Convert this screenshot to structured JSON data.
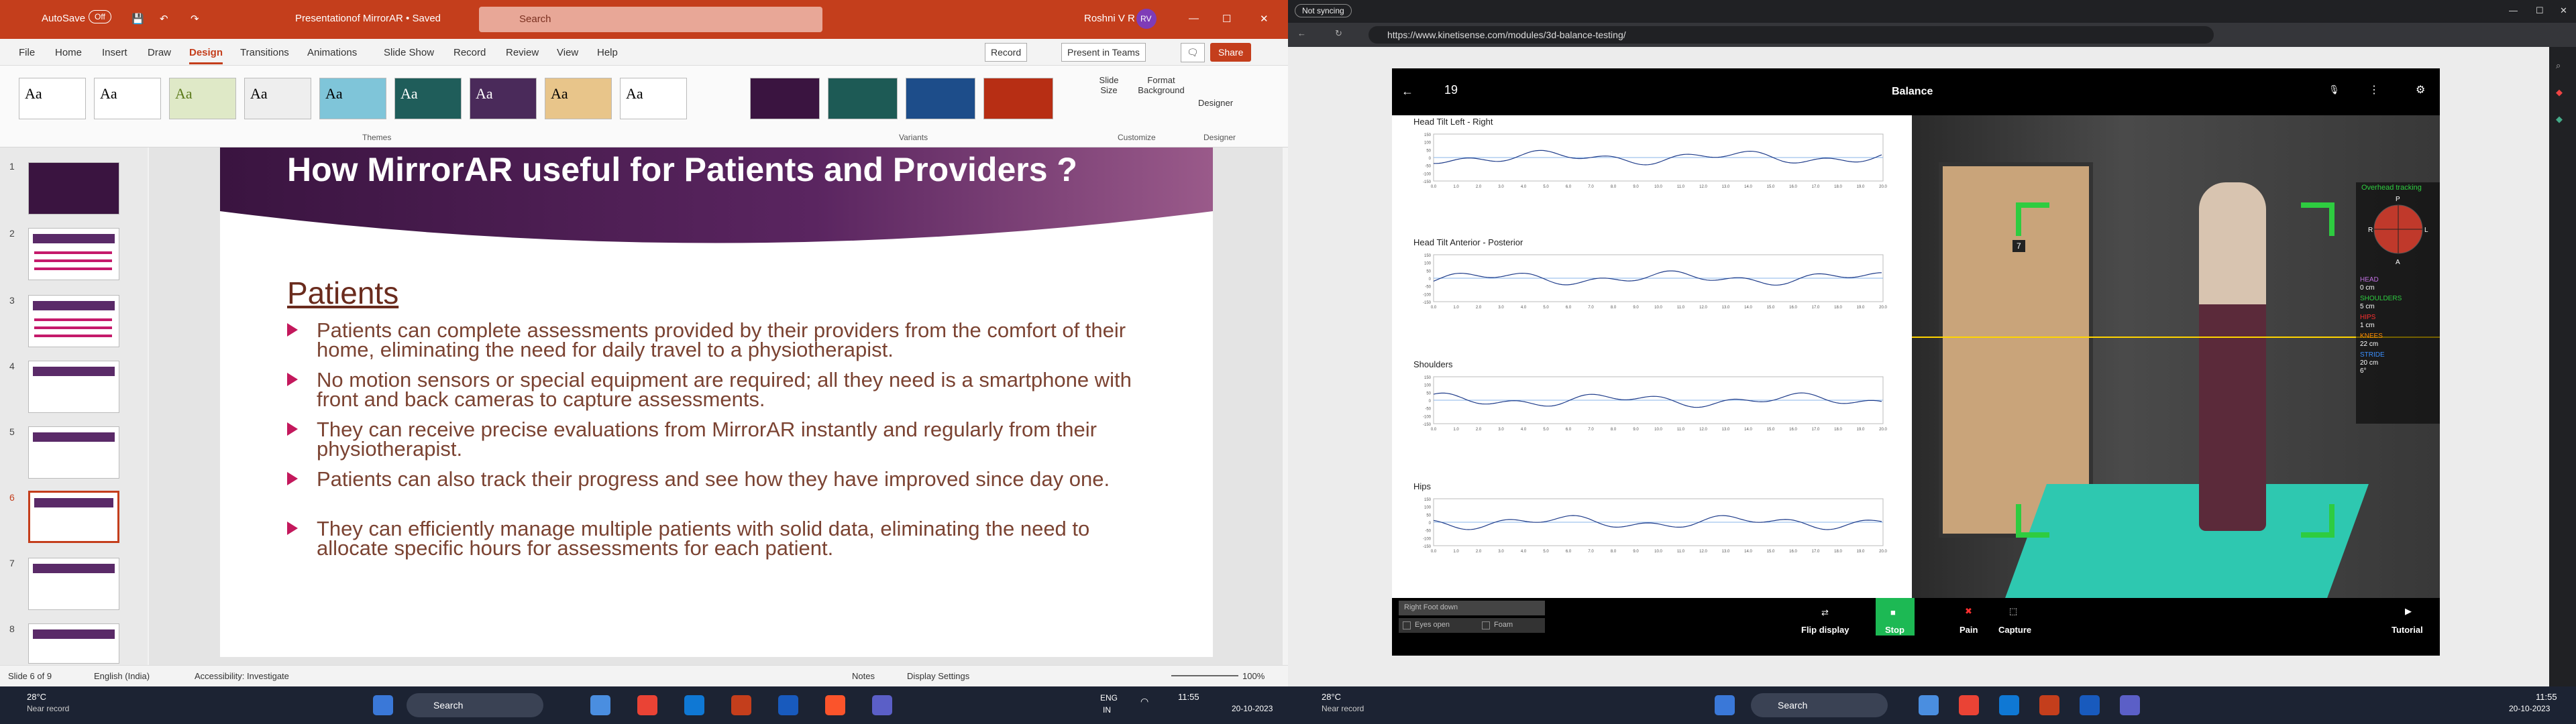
{
  "ppt": {
    "autosave_label": "AutoSave",
    "autosave_state": "Off",
    "doc_title": "Presentationof MirrorAR • Saved",
    "search_placeholder": "Search",
    "user_name": "Roshni V R",
    "user_initials": "RV",
    "menu": [
      "File",
      "Home",
      "Insert",
      "Draw",
      "Design",
      "Transitions",
      "Animations",
      "Slide Show",
      "Record",
      "Review",
      "View",
      "Help"
    ],
    "active_menu": "Design",
    "record_btn": "Record",
    "present_btn": "Present in Teams",
    "share_btn": "Share",
    "ribbon": {
      "themes_label": "Themes",
      "variants_label": "Variants",
      "customize_label": "Customize",
      "designer_group_label": "Designer",
      "slide_size": "Slide Size",
      "format_background": "Format Background",
      "designer": "Designer",
      "theme_sample": "Aa"
    },
    "thumb_numbers": [
      "1",
      "2",
      "3",
      "4",
      "5",
      "6",
      "7",
      "8"
    ],
    "active_slide": "6",
    "slide": {
      "title": "How MirrorAR useful for Patients and Providers ?",
      "heading": "Patients",
      "bullets": [
        "Patients can complete assessments provided by their providers from the comfort of their home, eliminating the need for daily travel to a physiotherapist.",
        "No motion sensors or special equipment are required; all they need is a smartphone with front and back cameras to capture assessments.",
        "They can receive precise evaluations from MirrorAR instantly and regularly from their physiotherapist.",
        "Patients can also track their progress and see how they have improved since day one.",
        "They can efficiently manage multiple patients with solid data, eliminating the need to allocate specific hours for assessments for each patient."
      ]
    },
    "status": {
      "slide_of": "Slide 6 of 9",
      "language": "English (India)",
      "accessibility": "Accessibility: Investigate",
      "notes": "Notes",
      "display_settings": "Display Settings",
      "zoom": "100%"
    }
  },
  "browser": {
    "sync_label": "Not syncing",
    "url": "https://www.kinetisense.com/modules/3d-balance-testing/",
    "app": {
      "title": "Balance",
      "counter": "19",
      "graph_titles": [
        "Head Tilt Left - Right",
        "Head Tilt Anterior - Posterior",
        "Shoulders",
        "Hips"
      ],
      "y_ticks": [
        "150",
        "100",
        "50",
        "0",
        "-50",
        "-100",
        "-150"
      ],
      "x_ticks": [
        "0.0",
        "1.0",
        "2.0",
        "3.0",
        "4.0",
        "5.0",
        "6.0",
        "7.0",
        "8.0",
        "9.0",
        "10.0",
        "11.0",
        "12.0",
        "13.0",
        "14.0",
        "15.0",
        "16.0",
        "17.0",
        "18.0",
        "19.0",
        "20.0"
      ],
      "overhead_label": "Overhead tracking",
      "compass": [
        "P",
        "R",
        "L",
        "A"
      ],
      "legend": [
        {
          "name": "HEAD",
          "value": "0 cm",
          "color": "#c070e0"
        },
        {
          "name": "SHOULDERS",
          "value": "5 cm",
          "color": "#2ecc40"
        },
        {
          "name": "HIPS",
          "value": "1 cm",
          "color": "#ff3030"
        },
        {
          "name": "KNEES",
          "value": "22 cm",
          "color": "#ff8c00"
        },
        {
          "name": "STRIDE",
          "value": "20 cm",
          "color": "#3a8fff"
        }
      ],
      "stride_extra": "6°",
      "door_number": "7",
      "dropdown": "Right Foot down",
      "checkboxes": [
        "Eyes open",
        "Foam"
      ],
      "buttons": [
        "Flip display",
        "Stop",
        "Pain",
        "Capture",
        "Tutorial"
      ]
    }
  },
  "taskbar": {
    "left_temp": "28°C",
    "left_weather": "Near record",
    "left_search": "Search",
    "lang1": "ENG",
    "lang2": "IN",
    "left_time": "11:55",
    "left_date": "20-10-2023",
    "right_temp": "28°C",
    "right_weather": "Near record",
    "right_search": "Search",
    "right_time": "11:55",
    "right_date": "20-10-2023"
  },
  "colors": {
    "ppt_accent": "#c43e1c",
    "slide_purple": "#3a1440",
    "bullet_magenta": "#c3185c",
    "stop_green": "#1db954"
  }
}
